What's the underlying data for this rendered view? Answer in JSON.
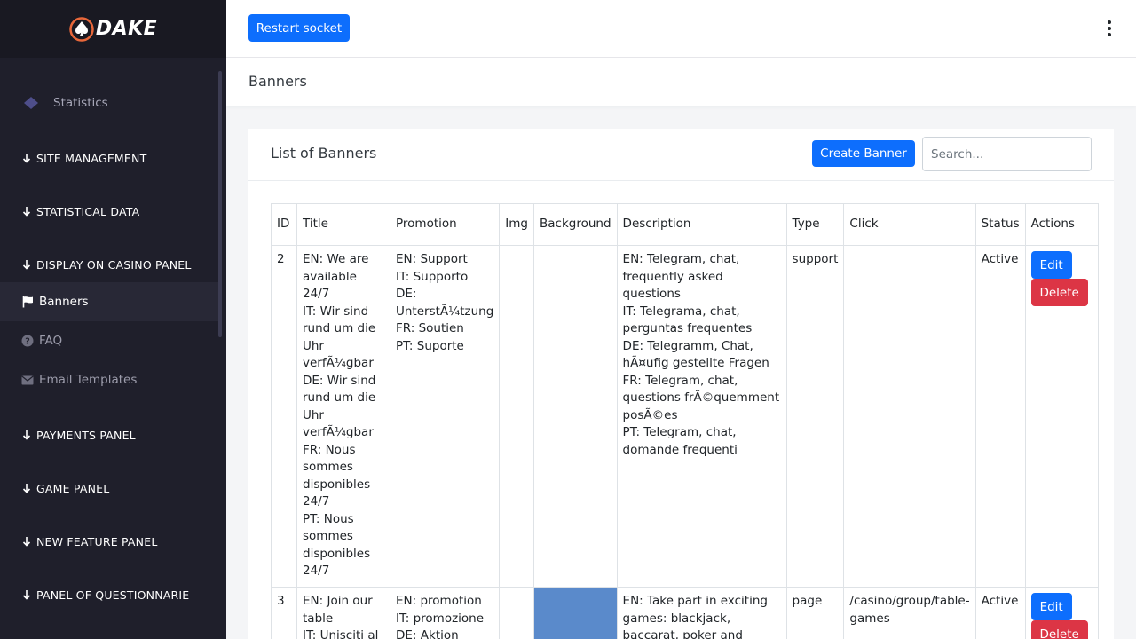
{
  "brand": {
    "name": "DAKE",
    "accent": "#e8673a"
  },
  "sidebar": {
    "statistics": "Statistics",
    "sections": [
      "SITE MANAGEMENT",
      "STATISTICAL DATA",
      "DISPLAY ON CASINO PANEL",
      "PAYMENTS PANEL",
      "GAME PANEL",
      "NEW FEATURE PANEL",
      "PANEL OF QUESTIONNARIE"
    ],
    "items": [
      {
        "label": "Banners",
        "icon": "flag-icon",
        "active": true
      },
      {
        "label": "FAQ",
        "icon": "question-circle-icon"
      },
      {
        "label": "Email Templates",
        "icon": "envelope-icon"
      }
    ]
  },
  "topbar": {
    "restart_label": "Restart socket",
    "menu_icon": "kebab-menu-icon"
  },
  "page": {
    "title": "Banners"
  },
  "card": {
    "title": "List of Banners",
    "create_label": "Create Banner",
    "search_placeholder": "Search..."
  },
  "table": {
    "headers": [
      "ID",
      "Title",
      "Promotion",
      "Img",
      "Background",
      "Description",
      "Type",
      "Click",
      "Status",
      "Actions"
    ],
    "edit_label": "Edit",
    "delete_label": "Delete",
    "rows": [
      {
        "id": "2",
        "title": [
          "EN: We are available 24/7",
          "IT: Wir sind rund um die Uhr verfÃ¼gbar",
          "DE: Wir sind rund um die Uhr verfÃ¼gbar",
          "FR: Nous sommes disponibles 24/7",
          "PT: Nous sommes disponibles 24/7"
        ],
        "promotion": [
          "EN: Support",
          "IT: Supporto",
          "DE: UnterstÃ¼tzung",
          "FR: Soutien",
          "PT: Suporte"
        ],
        "img": "",
        "background": "#a52a2a",
        "description": [
          "EN: Telegram, chat, frequently asked questions",
          "IT: Telegrama, chat, perguntas frequentes",
          "DE: Telegramm, Chat, hÃ¤ufig gestellte Fragen",
          "FR: Telegram, chat, questions frÃ©quemment posÃ©es",
          "PT: Telegram, chat, domande frequenti"
        ],
        "type": "support",
        "click": "",
        "status": "Active"
      },
      {
        "id": "3",
        "title": [
          "EN: Join our table",
          "IT: Unisciti al"
        ],
        "promotion": [
          "EN: promotion",
          "IT: promozione",
          "DE: Aktion"
        ],
        "img": "",
        "background": "#5a8acb",
        "description": [
          "EN: Take part in exciting games: blackjack, baccarat, poker and more."
        ],
        "type": "page",
        "click": "/casino/group/table-games",
        "status": "Active"
      }
    ]
  }
}
